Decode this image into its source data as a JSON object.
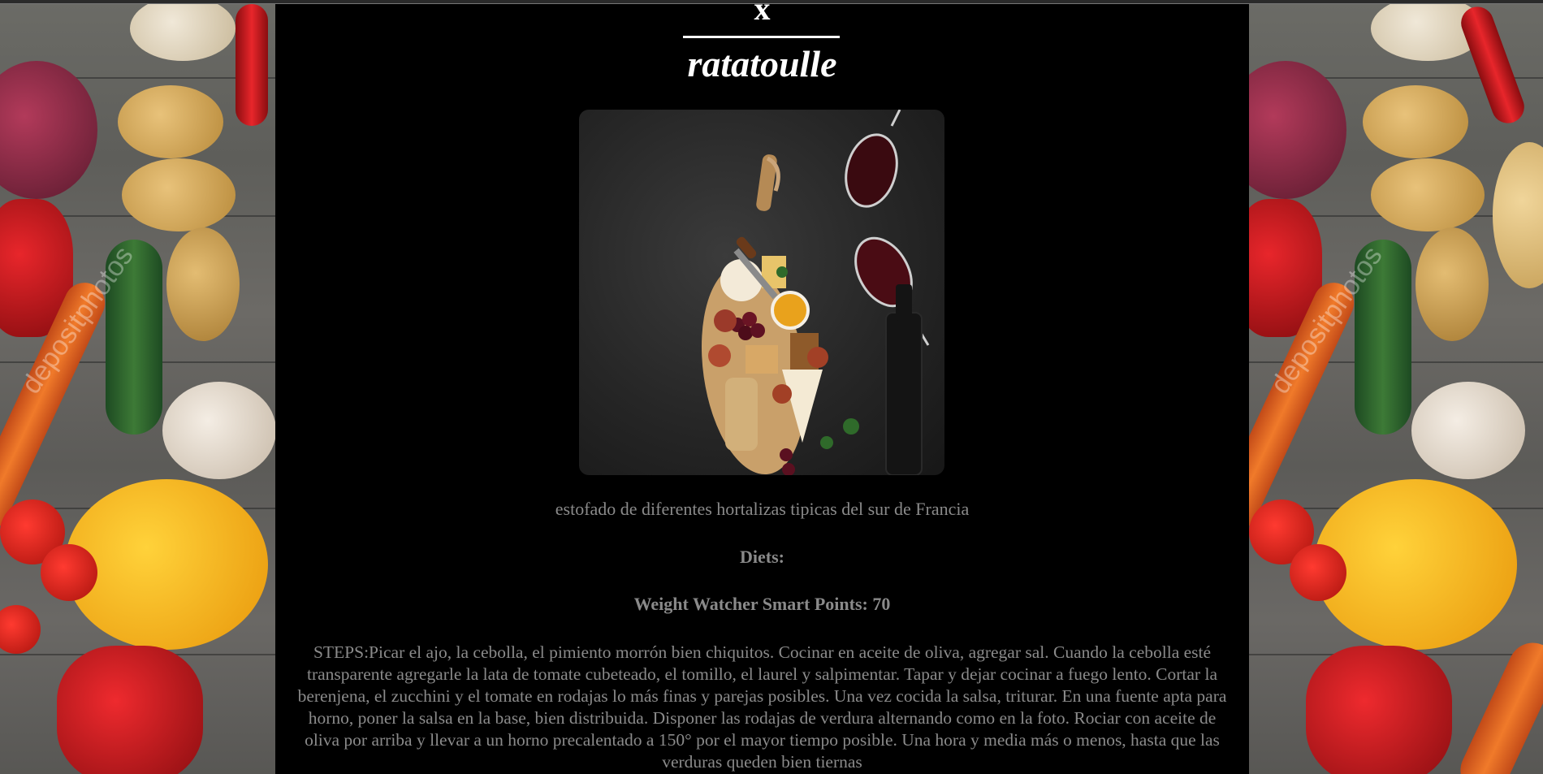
{
  "modal": {
    "close_label": "x",
    "title": "ratatoulle",
    "summary": "estofado de diferentes hortalizas tipicas del sur de Francia",
    "diets_label": "Diets:",
    "points_text": "Weight Watcher Smart Points: 70",
    "steps_text": "STEPS:Picar el ajo, la cebolla, el pimiento morrón bien chiquitos. Cocinar en aceite de oliva, agregar sal. Cuando la cebolla esté transparente agregarle la lata de tomate cubeteado, el tomillo, el laurel y salpimentar. Tapar y dejar cocinar a fuego lento. Cortar la berenjena, el zucchini y el tomate en rodajas lo más finas y parejas posibles. Una vez cocida la salsa, triturar. En una fuente apta para horno, poner la salsa en la base, bien distribuida. Disponer las rodajas de verdura alternando como en la foto. Rociar con aceite de oliva por arriba y llevar a un horno precalentado a 150° por el mayor tiempo posible. Una hora y media más o menos, hasta que las verduras queden bien tiernas"
  },
  "background": {
    "watermark": "depositphotos"
  },
  "colors": {
    "panel": "#000000",
    "title": "#ffffff",
    "body_text": "#8a8a8a"
  }
}
